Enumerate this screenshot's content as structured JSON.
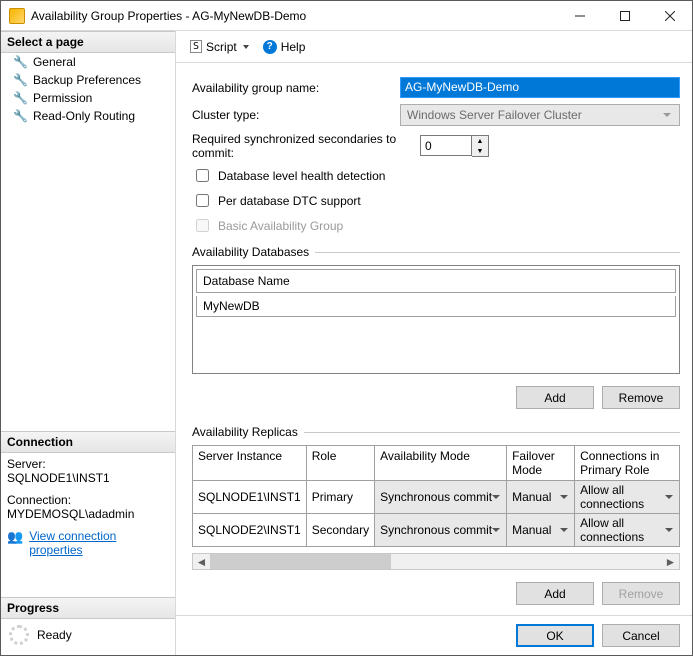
{
  "window": {
    "title": "Availability Group Properties - AG-MyNewDB-Demo"
  },
  "sidebar": {
    "select_page": "Select a page",
    "pages": [
      {
        "label": "General"
      },
      {
        "label": "Backup Preferences"
      },
      {
        "label": "Permission"
      },
      {
        "label": "Read-Only Routing"
      }
    ],
    "connection_head": "Connection",
    "server_label": "Server:",
    "server_value": "SQLNODE1\\INST1",
    "connection_label": "Connection:",
    "connection_value": "MYDEMOSQL\\adadmin",
    "view_conn_props": "View connection properties",
    "progress_head": "Progress",
    "progress_status": "Ready"
  },
  "toolbar": {
    "script": "Script",
    "help": "Help"
  },
  "form": {
    "ag_name_label": "Availability group name:",
    "ag_name_value": "AG-MyNewDB-Demo",
    "cluster_type_label": "Cluster type:",
    "cluster_type_value": "Windows Server Failover Cluster",
    "req_sync_label": "Required synchronized secondaries to commit:",
    "req_sync_value": "0",
    "db_health": "Database level health detection",
    "per_db_dtc": "Per database DTC support",
    "basic_ag": "Basic Availability Group"
  },
  "databases": {
    "group_label": "Availability Databases",
    "col_name": "Database Name",
    "rows": [
      {
        "name": "MyNewDB"
      }
    ],
    "add": "Add",
    "remove": "Remove"
  },
  "replicas": {
    "group_label": "Availability Replicas",
    "cols": {
      "server": "Server Instance",
      "role": "Role",
      "mode": "Availability Mode",
      "failover": "Failover Mode",
      "conn_primary": "Connections in Primary Role"
    },
    "rows": [
      {
        "server": "SQLNODE1\\INST1",
        "role": "Primary",
        "mode": "Synchronous commit",
        "failover": "Manual",
        "conn": "Allow all connections"
      },
      {
        "server": "SQLNODE2\\INST1",
        "role": "Secondary",
        "mode": "Synchronous commit",
        "failover": "Manual",
        "conn": "Allow all connections"
      }
    ],
    "add": "Add",
    "remove": "Remove"
  },
  "footer": {
    "ok": "OK",
    "cancel": "Cancel"
  }
}
